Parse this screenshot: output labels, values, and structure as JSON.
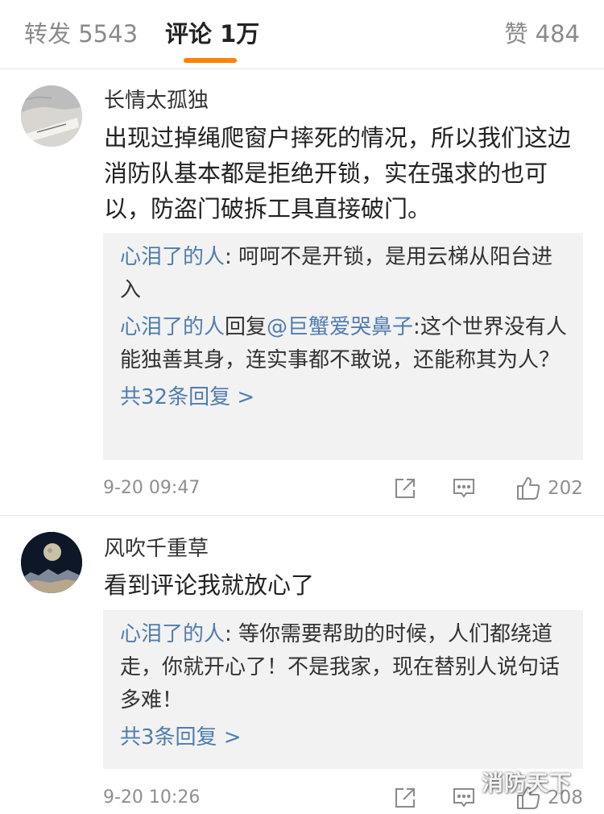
{
  "tabs": {
    "repost": "转发 5543",
    "comments": "评论 1万",
    "likes": "赞 484",
    "accent_color": "#ff8200"
  },
  "comments": [
    {
      "username": "长情太孤独",
      "text": "出现过掉绳爬窗户摔死的情况，所以我们这边消防队基本都是拒绝开锁，实在强求的也可以，防盗门破拆工具直接破门。",
      "replies": [
        {
          "nick": "心泪了的人",
          "sep": ": ",
          "text": "呵呵不是开锁，是用云梯从阳台进入"
        },
        {
          "nick": "心泪了的人",
          "mid": "回复",
          "mention": "@巨蟹爱哭鼻子",
          "sep": ":",
          "text": "这个世界没有人能独善其身，连实事都不敢说，还能称其为人？"
        }
      ],
      "more": "共32条回复 >",
      "time": "9-20 09:47",
      "likes": "202"
    },
    {
      "username": "风吹千重草",
      "text": "看到评论我就放心了",
      "replies": [
        {
          "nick": "心泪了的人",
          "sep": ": ",
          "text": "等你需要帮助的时候，人们都绕道走，你就开心了！不是我家，现在替别人说句话多难！"
        }
      ],
      "more": "共3条回复 >",
      "time": "9-20 10:26",
      "likes": "208"
    }
  ],
  "watermark": "消防天下",
  "link_color": "#507daf",
  "icons": [
    "share-icon",
    "comment-icon",
    "like-icon"
  ]
}
